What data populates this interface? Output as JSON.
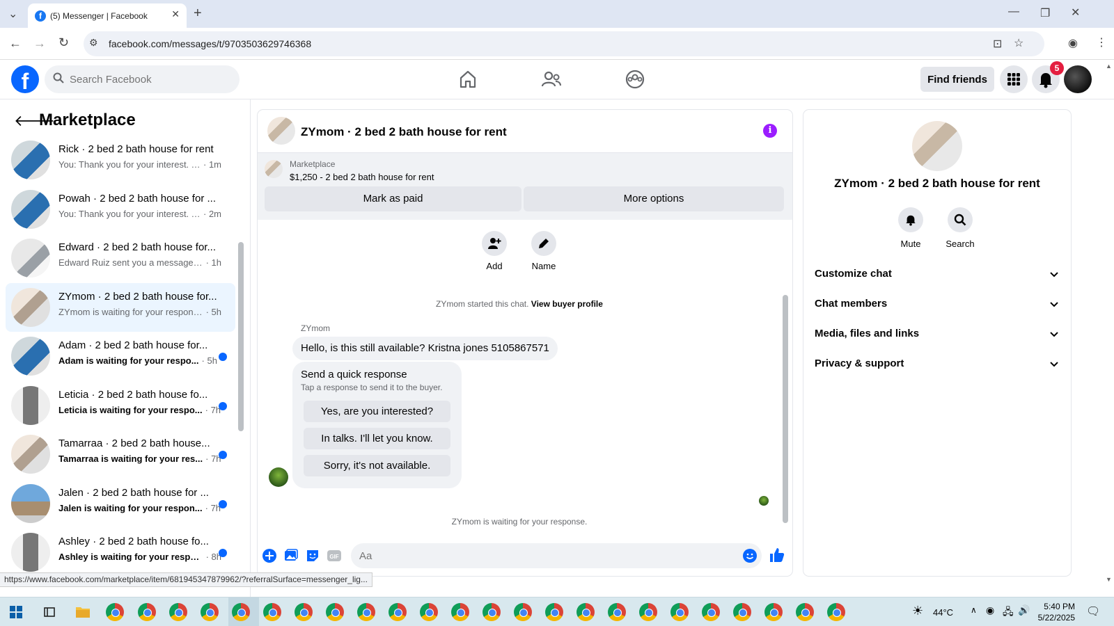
{
  "browser": {
    "tab_title": "(5) Messenger | Facebook",
    "url": "facebook.com/messages/t/9703503629746368"
  },
  "topbar": {
    "search_placeholder": "Search Facebook",
    "find_friends": "Find friends",
    "notification_count": "5"
  },
  "sidebar": {
    "title": "Marketplace",
    "conversations": [
      {
        "name": "Rick · 2 bed 2 bath house for rent",
        "snippet": "You: Thank you for your interest. T...",
        "time": "1m",
        "unread": false
      },
      {
        "name": "Powah · 2 bed 2 bath house for ...",
        "snippet": "You: Thank you for your interest. T...",
        "time": "2m",
        "unread": false
      },
      {
        "name": "Edward · 2 bed 2 bath house for...",
        "snippet": "Edward Ruiz sent you a message a...",
        "time": "1h",
        "unread": false
      },
      {
        "name": "ZYmom · 2 bed 2 bath house for...",
        "snippet": "ZYmom is waiting for your response.",
        "time": "5h",
        "unread": false
      },
      {
        "name": "Adam · 2 bed 2 bath house for...",
        "snippet": "Adam is waiting for your respo...",
        "time": "5h",
        "unread": true
      },
      {
        "name": "Leticia · 2 bed 2 bath house fo...",
        "snippet": "Leticia is waiting for your respo...",
        "time": "7h",
        "unread": true
      },
      {
        "name": "Tamarraa · 2 bed 2 bath house...",
        "snippet": "Tamarraa is waiting for your res...",
        "time": "7h",
        "unread": true
      },
      {
        "name": "Jalen · 2 bed 2 bath house for ...",
        "snippet": "Jalen is waiting for your respon...",
        "time": "7h",
        "unread": true
      },
      {
        "name": "Ashley · 2 bed 2 bath house fo...",
        "snippet": "Ashley is waiting for your respo...",
        "time": "8h",
        "unread": true
      }
    ]
  },
  "chat": {
    "title": "ZYmom · 2 bed 2 bath house for rent",
    "marketplace_label": "Marketplace",
    "listing": "$1,250 - 2 bed 2 bath house for rent",
    "mark_paid": "Mark as paid",
    "more_options": "More options",
    "add_label": "Add",
    "name_label": "Name",
    "started_text": "ZYmom started this chat.",
    "view_profile": "View buyer profile",
    "sender": "ZYmom",
    "message": "Hello, is this still available? Kristna jones 5105867571",
    "quick_title": "Send a quick response",
    "quick_sub": "Tap a response to send it to the buyer.",
    "quick_responses": [
      "Yes, are you interested?",
      "In talks. I'll let you know.",
      "Sorry, it's not available."
    ],
    "waiting_text": "ZYmom is waiting for your response.",
    "input_placeholder": "Aa"
  },
  "right_panel": {
    "name": "ZYmom · 2 bed 2 bath house for rent",
    "mute": "Mute",
    "search": "Search",
    "sections": [
      "Customize chat",
      "Chat members",
      "Media, files and links",
      "Privacy & support"
    ]
  },
  "status_url": "https://www.facebook.com/marketplace/item/681945347879962/?referralSurface=messenger_lig...",
  "taskbar": {
    "temperature": "44°C",
    "time": "5:40 PM",
    "date": "5/22/2025"
  },
  "colors": {
    "fb_blue": "#0866ff",
    "active_conv": "#ebf5ff",
    "info_purple": "#9b1dff"
  }
}
